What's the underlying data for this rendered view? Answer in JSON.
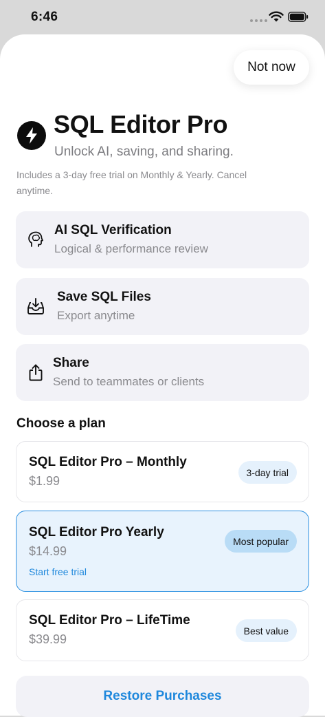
{
  "status_bar": {
    "time": "6:46"
  },
  "header": {
    "dismiss_label": "Not now",
    "title": "SQL Editor Pro",
    "subtitle": "Unlock AI, saving, and sharing.",
    "trial_note": "Includes a 3-day free trial on Monthly & Yearly. Cancel anytime."
  },
  "features": [
    {
      "icon": "brain-head-icon",
      "title": "AI SQL Verification",
      "subtitle": "Logical & performance review"
    },
    {
      "icon": "tray-download-icon",
      "title": "Save SQL Files",
      "subtitle": "Export anytime"
    },
    {
      "icon": "share-icon",
      "title": "Share",
      "subtitle": "Send to teammates or clients"
    }
  ],
  "plans_section": {
    "heading": "Choose a plan",
    "plans": [
      {
        "name": "SQL Editor Pro – Monthly",
        "price": "$1.99",
        "badge": "3-day trial",
        "selected": false
      },
      {
        "name": "SQL Editor Pro Yearly",
        "price": "$14.99",
        "badge": "Most popular",
        "cta": "Start free trial",
        "selected": true
      },
      {
        "name": "SQL Editor Pro – LifeTime",
        "price": "$39.99",
        "badge": "Best value",
        "selected": false
      }
    ]
  },
  "footer": {
    "restore_label": "Restore Purchases"
  },
  "colors": {
    "accent": "#1f88dc",
    "selected_bg": "#e8f3fd",
    "card_bg": "#f2f2f7"
  }
}
